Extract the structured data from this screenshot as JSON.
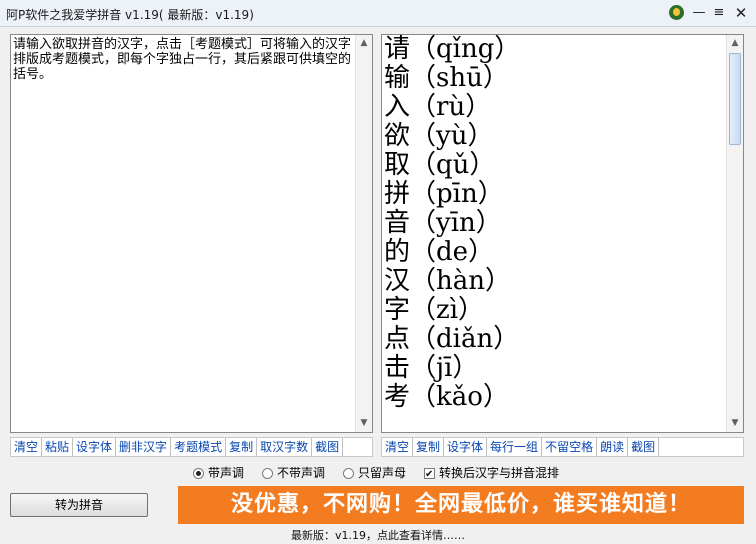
{
  "window": {
    "title": "阿P软件之我爱学拼音 v1.19( 最新版：v1.19)",
    "icons": [
      "qq-logo-icon",
      "minimize-icon",
      "menu-icon",
      "close-icon"
    ]
  },
  "left_pane": {
    "text": "请输入欲取拼音的汉字，点击［考题模式］可将输入的汉字排版成考题模式，即每个字独占一行，其后紧跟可供填空的括号。"
  },
  "right_pane": {
    "rows": [
      {
        "char": "请",
        "pinyin": "qǐng"
      },
      {
        "char": "输",
        "pinyin": "shū"
      },
      {
        "char": "入",
        "pinyin": "rù"
      },
      {
        "char": "欲",
        "pinyin": "yù"
      },
      {
        "char": "取",
        "pinyin": "qǔ"
      },
      {
        "char": "拼",
        "pinyin": "pīn"
      },
      {
        "char": "音",
        "pinyin": "yīn"
      },
      {
        "char": "的",
        "pinyin": "de"
      },
      {
        "char": "汉",
        "pinyin": "hàn"
      },
      {
        "char": "字",
        "pinyin": "zì"
      },
      {
        "char": "点",
        "pinyin": "diǎn"
      },
      {
        "char": "击",
        "pinyin": "jī"
      },
      {
        "char": "考",
        "pinyin": "kǎo"
      }
    ]
  },
  "left_toolbar": {
    "clear": "清空",
    "paste": "粘贴",
    "font": "设字体",
    "remove_non_han": "删非汉字",
    "exam_mode": "考题模式",
    "copy": "复制",
    "count": "取汉字数",
    "screenshot": "截图"
  },
  "right_toolbar": {
    "clear": "清空",
    "copy": "复制",
    "font": "设字体",
    "group": "每行一组",
    "no_space": "不留空格",
    "read": "朗读",
    "screenshot": "截图"
  },
  "options": {
    "with_tone": "带声调",
    "without_tone": "不带声调",
    "initials_only": "只留声母",
    "mix_label": "转换后汉字与拼音混排",
    "selected_tone_option": "with_tone",
    "mix_checked": true
  },
  "convert_button": "转为拼音",
  "banner": "没优惠，不网购！全网最低价，谁买谁知道！",
  "status": "最新版：v1.19，点此查看详情……",
  "colors": {
    "banner_bg": "#f47c20",
    "link": "#0a47b0"
  }
}
